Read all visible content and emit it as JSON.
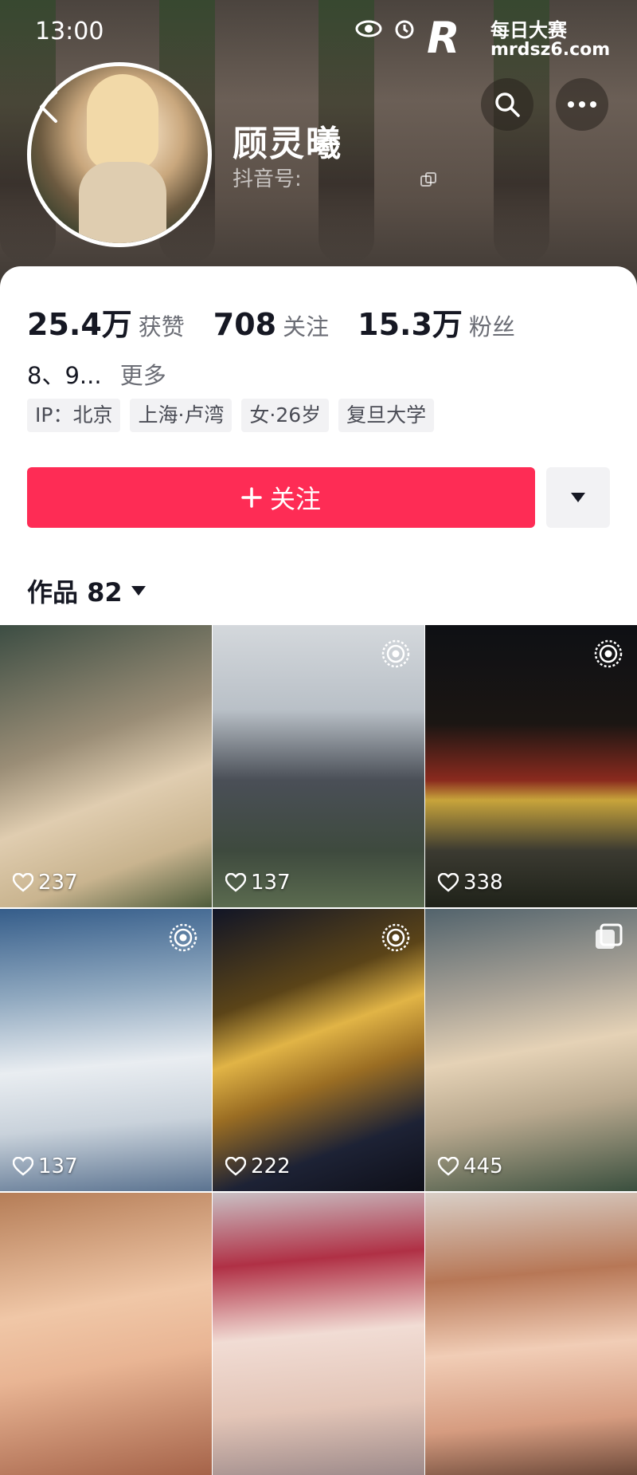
{
  "status_bar": {
    "time": "13:00"
  },
  "watermark": {
    "logo": "R",
    "line1": "每日大赛",
    "line2": "mrdsz6.com"
  },
  "profile": {
    "name": "顾灵曦",
    "douyin_id_label": "抖音号:"
  },
  "stats": [
    {
      "value": "25.4万",
      "label": "获赞"
    },
    {
      "value": "708",
      "label": "关注"
    },
    {
      "value": "15.3万",
      "label": "粉丝"
    }
  ],
  "bio": {
    "text": "8、9...",
    "more": "更多"
  },
  "tags": [
    "IP：北京",
    "上海·卢湾",
    "女·26岁",
    "复旦大学"
  ],
  "follow_button": {
    "label": "关注"
  },
  "works": {
    "label": "作品 82"
  },
  "videos": [
    {
      "likes": "237",
      "badge": "none"
    },
    {
      "likes": "137",
      "badge": "live-photo"
    },
    {
      "likes": "338",
      "badge": "live-photo"
    },
    {
      "likes": "137",
      "badge": "live-photo"
    },
    {
      "likes": "222",
      "badge": "live-photo"
    },
    {
      "likes": "445",
      "badge": "multi-image"
    },
    {
      "likes": "",
      "badge": "none"
    },
    {
      "likes": "",
      "badge": "none"
    },
    {
      "likes": "",
      "badge": "none"
    }
  ],
  "colors": {
    "accent": "#fe2c55",
    "text_primary": "#161823",
    "text_secondary": "#6b6d75",
    "tag_bg": "#f2f2f4"
  }
}
